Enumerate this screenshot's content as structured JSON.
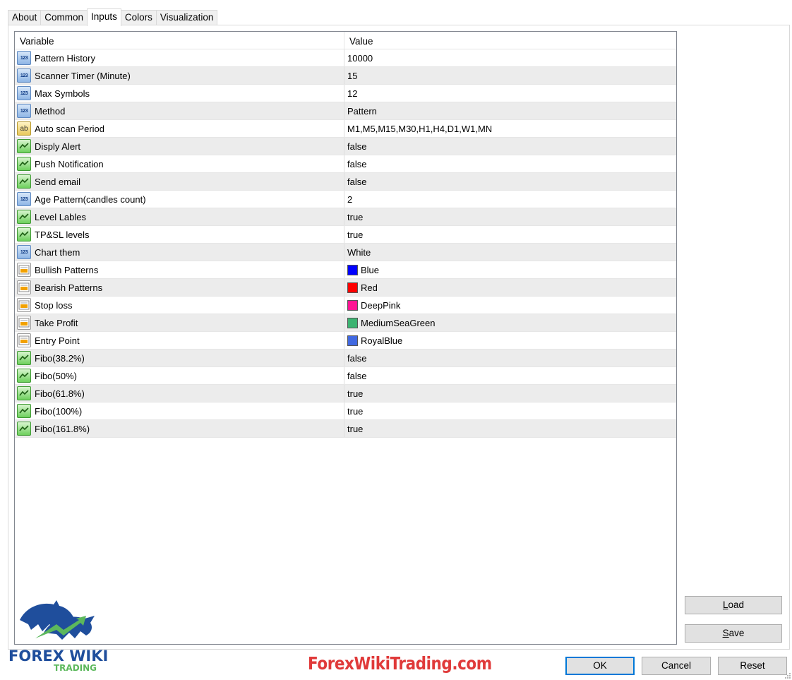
{
  "tabs": [
    "About",
    "Common",
    "Inputs",
    "Colors",
    "Visualization"
  ],
  "active_tab": "Inputs",
  "table": {
    "header_variable": "Variable",
    "header_value": "Value",
    "rows": [
      {
        "icon": "number-type-icon",
        "icon_text": "123",
        "variable": "Pattern History",
        "value": "10000"
      },
      {
        "icon": "number-type-icon",
        "icon_text": "123",
        "variable": "Scanner Timer (Minute)",
        "value": "15"
      },
      {
        "icon": "number-type-icon",
        "icon_text": "123",
        "variable": "Max Symbols",
        "value": "12"
      },
      {
        "icon": "number-type-icon",
        "icon_text": "123",
        "variable": "Method",
        "value": "Pattern"
      },
      {
        "icon": "string-type-icon",
        "icon_text": "ab",
        "variable": "Auto scan Period",
        "value": "M1,M5,M15,M30,H1,H4,D1,W1,MN"
      },
      {
        "icon": "bool-type-icon",
        "variable": "Disply Alert",
        "value": "false"
      },
      {
        "icon": "bool-type-icon",
        "variable": "Push Notification",
        "value": "false"
      },
      {
        "icon": "bool-type-icon",
        "variable": "Send email",
        "value": "false"
      },
      {
        "icon": "number-type-icon",
        "icon_text": "123",
        "variable": "Age Pattern(candles count)",
        "value": "2"
      },
      {
        "icon": "bool-type-icon",
        "variable": "Level Lables",
        "value": "true"
      },
      {
        "icon": "bool-type-icon",
        "variable": "TP&SL levels",
        "value": "true"
      },
      {
        "icon": "number-type-icon",
        "icon_text": "123",
        "variable": "Chart them",
        "value": "White"
      },
      {
        "icon": "color-type-icon",
        "variable": "Bullish Patterns",
        "value": "Blue",
        "swatch": "#0000ff"
      },
      {
        "icon": "color-type-icon",
        "variable": "Bearish Patterns",
        "value": "Red",
        "swatch": "#ff0000"
      },
      {
        "icon": "color-type-icon",
        "variable": "Stop loss",
        "value": "DeepPink",
        "swatch": "#ff1493"
      },
      {
        "icon": "color-type-icon",
        "variable": "Take Profit",
        "value": "MediumSeaGreen",
        "swatch": "#3cb371"
      },
      {
        "icon": "color-type-icon",
        "variable": "Entry Point",
        "value": "RoyalBlue",
        "swatch": "#4169e1"
      },
      {
        "icon": "bool-type-icon",
        "variable": "Fibo(38.2%)",
        "value": "false"
      },
      {
        "icon": "bool-type-icon",
        "variable": "Fibo(50%)",
        "value": "false"
      },
      {
        "icon": "bool-type-icon",
        "variable": "Fibo(61.8%)",
        "value": "true"
      },
      {
        "icon": "bool-type-icon",
        "variable": "Fibo(100%)",
        "value": "true"
      },
      {
        "icon": "bool-type-icon",
        "variable": "Fibo(161.8%)",
        "value": "true"
      }
    ]
  },
  "buttons": {
    "load": "Load",
    "save": "Save",
    "ok": "OK",
    "cancel": "Cancel",
    "reset": "Reset"
  },
  "watermark": {
    "site": "ForexWikiTrading.com",
    "logo_text_main": "FOREX WIKI",
    "logo_text_sub": "TRADING",
    "accent": "#e03a3a",
    "logo_blue": "#1f4e9c",
    "logo_green": "#5cb85c"
  }
}
